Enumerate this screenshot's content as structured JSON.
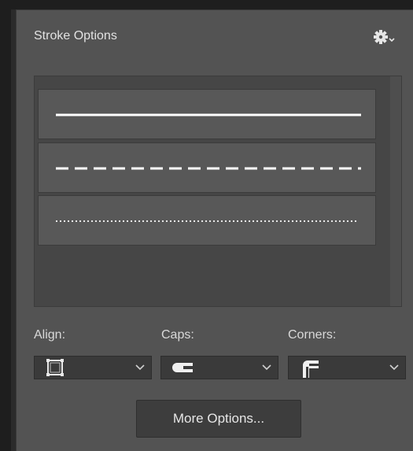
{
  "panel": {
    "title": "Stroke Options"
  },
  "icons": {
    "settings": "gear-icon",
    "align": "align-stroke-inside-icon",
    "caps": "butt-cap-icon",
    "corners": "miter-corner-icon",
    "dropdown": "chevron-down-icon"
  },
  "stroke_presets": [
    {
      "style": "solid"
    },
    {
      "style": "dashed"
    },
    {
      "style": "dotted"
    }
  ],
  "controls": {
    "align_label": "Align:",
    "caps_label": "Caps:",
    "corners_label": "Corners:"
  },
  "buttons": {
    "more_options": "More Options..."
  },
  "colors": {
    "panel_bg": "#535353",
    "field_bg": "#3a3a3a",
    "stroke_color": "#ffffff",
    "text": "#d6d6d6"
  }
}
